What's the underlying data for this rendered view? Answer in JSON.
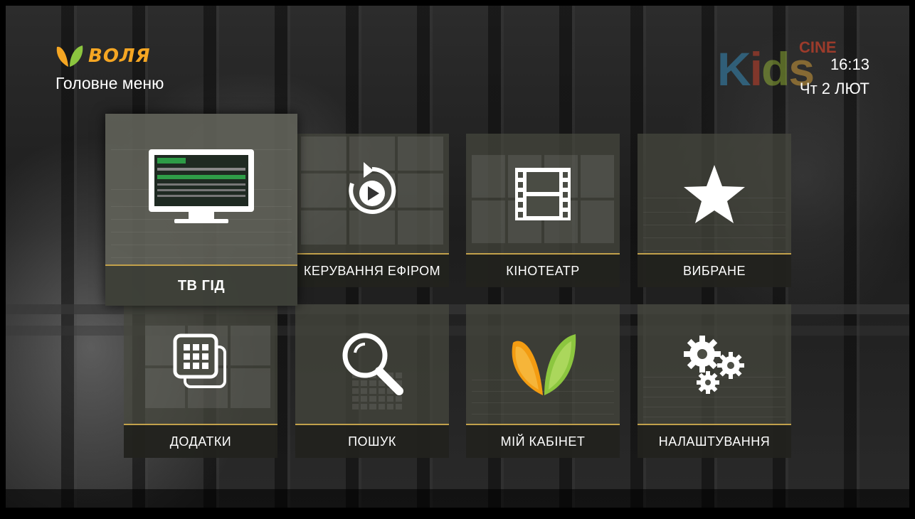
{
  "brand": {
    "name": "ВОЛЯ",
    "accent": "#f5a623"
  },
  "page_title": "Головне меню",
  "channel": {
    "logo_main": "Kids",
    "logo_sup": "CINE"
  },
  "status": {
    "time": "16:13",
    "date": "Чт 2 ЛЮТ"
  },
  "menu": {
    "selected": "tv-guide",
    "items": [
      {
        "id": "tv-guide",
        "label": "ТВ ГІД",
        "icon": "monitor-icon"
      },
      {
        "id": "broadcast-control",
        "label": "КЕРУВАННЯ ЕФІРОМ",
        "icon": "replay-icon"
      },
      {
        "id": "cinema",
        "label": "КІНОТЕАТР",
        "icon": "film-icon"
      },
      {
        "id": "favorites",
        "label": "ВИБРАНЕ",
        "icon": "star-icon"
      },
      {
        "id": "apps",
        "label": "ДОДАТКИ",
        "icon": "apps-icon"
      },
      {
        "id": "search",
        "label": "ПОШУК",
        "icon": "search-icon"
      },
      {
        "id": "my-account",
        "label": "МІЙ КАБІНЕТ",
        "icon": "volia-logo-icon"
      },
      {
        "id": "settings",
        "label": "НАЛАШТУВАННЯ",
        "icon": "gears-icon"
      }
    ]
  }
}
